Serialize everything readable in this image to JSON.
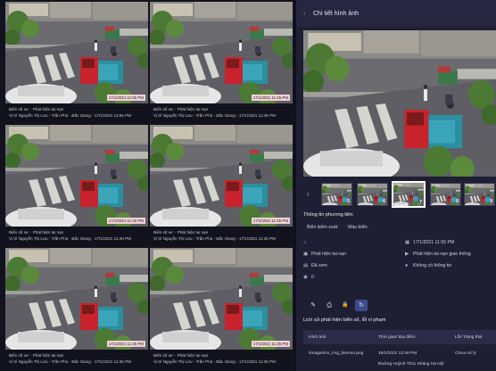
{
  "grid": {
    "cells": [
      {
        "line1": "Biển số xe: · Phát hiện tai nạn",
        "line2": "Vị trí Nguyễn Thị Lưu - Trần Phú - Bắc Giang - 17/1/2021 11:55 PM",
        "timestamp": "17/1/2021 11:55 PM"
      },
      {
        "line1": "Biển số xe: · Phát hiện tai nạn",
        "line2": "Vị trí Nguyễn Thị Lưu - Trần Phú - Bắc Giang - 17/1/2021 11:45 PM",
        "timestamp": "17/1/2021 11:45 PM"
      },
      {
        "line1": "Biển số xe: · Phát hiện tai nạn",
        "line2": "Vị trí Nguyễn Thị Lưu - Trần Phú - Bắc Giang - 17/1/2021 11:40 PM",
        "timestamp": "17/1/2021 11:40 PM"
      },
      {
        "line1": "Biển số xe: · Phát hiện tai nạn",
        "line2": "Vị trí Nguyễn Thị Lưu - Trần Phú - Bắc Giang - 17/1/2021 11:35 PM",
        "timestamp": "17/1/2021 11:35 PM"
      },
      {
        "line1": "Biển số xe: · Phát hiện tai nạn",
        "line2": "Vị trí Nguyễn Thị Lưu - Trần Phú - Bắc Giang - 17/1/2021 11:35 PM",
        "timestamp": "17/1/2021 11:35 PM"
      },
      {
        "line1": "Biển số xe: · Phát hiện tai nạn",
        "line2": "Vị trí Nguyễn Thị Lưu - Trần Phú - Bắc Giang - 17/1/2021 11:35 PM",
        "timestamp": "17/1/2021 11:35 PM"
      }
    ]
  },
  "panel": {
    "title": "Chi tiết hình ảnh",
    "thumbnails": [
      {
        "num": "5",
        "selected": false
      },
      {
        "num": "6",
        "selected": false
      },
      {
        "num": "7",
        "selected": true
      },
      {
        "num": "8",
        "selected": false
      },
      {
        "num": "9",
        "selected": false
      }
    ],
    "info": {
      "title": "Thông tin phương tiện:",
      "plate_label": "Biển kiểm soát:",
      "color_label": "Màu biển:",
      "timestamp": "17/1/2021 11:55 PM",
      "event": "Phát hiện tai nạn",
      "source": "Phát hiện tai nạn giao thông",
      "status": "Đã xem",
      "info_note": "Không có thông tin",
      "count": "0"
    },
    "actions": [
      {
        "icon": "pencil-icon",
        "glyph": "✎"
      },
      {
        "icon": "printer-icon",
        "glyph": "⎙"
      },
      {
        "icon": "lock-icon",
        "glyph": "🔒"
      },
      {
        "icon": "history-icon",
        "glyph": "↻"
      }
    ],
    "history": {
      "title": "Lịch sử phát hiện biển số, lỗi vi phạm",
      "headers": [
        "Hình ảnh",
        "Thời gian/ Địa điểm",
        "Lỗi/ Trạng thái"
      ],
      "rows": [
        {
          "image": "/images/no_img_biemso.png",
          "time": "19/1/2021 12:49 PM",
          "status": "Chưa xử lý",
          "place": "Đường Huỳnh Thúc Kháng Hà Nội"
        }
      ]
    }
  },
  "colors": {
    "accent": "#3d4a8c",
    "timestamp_bg": "#f2d2d6",
    "road": "#5e5e64",
    "truck_red": "#c8232c",
    "truck_teal": "#2a8fa0"
  }
}
